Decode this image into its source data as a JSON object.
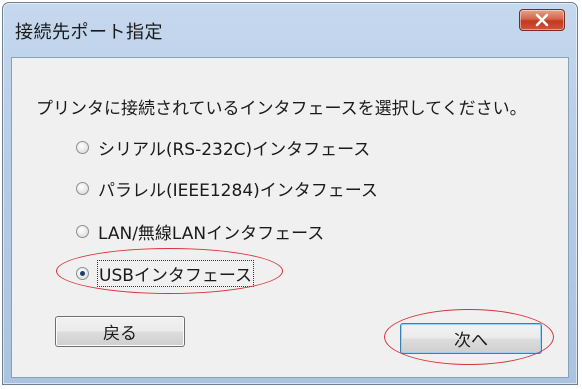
{
  "window": {
    "title": "接続先ポート指定"
  },
  "dialog": {
    "prompt": "プリンタに接続されているインタフェースを選択してください。",
    "options": [
      {
        "label": "シリアル(RS-232C)インタフェース",
        "checked": false
      },
      {
        "label": "パラレル(IEEE1284)インタフェース",
        "checked": false
      },
      {
        "label": "LAN/無線LANインタフェース",
        "checked": false
      },
      {
        "label": "USBインタフェース",
        "checked": true
      }
    ],
    "back_label": "戻る",
    "next_label": "次へ"
  },
  "colors": {
    "highlight": "#d8323a",
    "close_button": "#c2391c",
    "titlebar": "#b7cde6"
  },
  "icons": {
    "close": "close-icon"
  }
}
